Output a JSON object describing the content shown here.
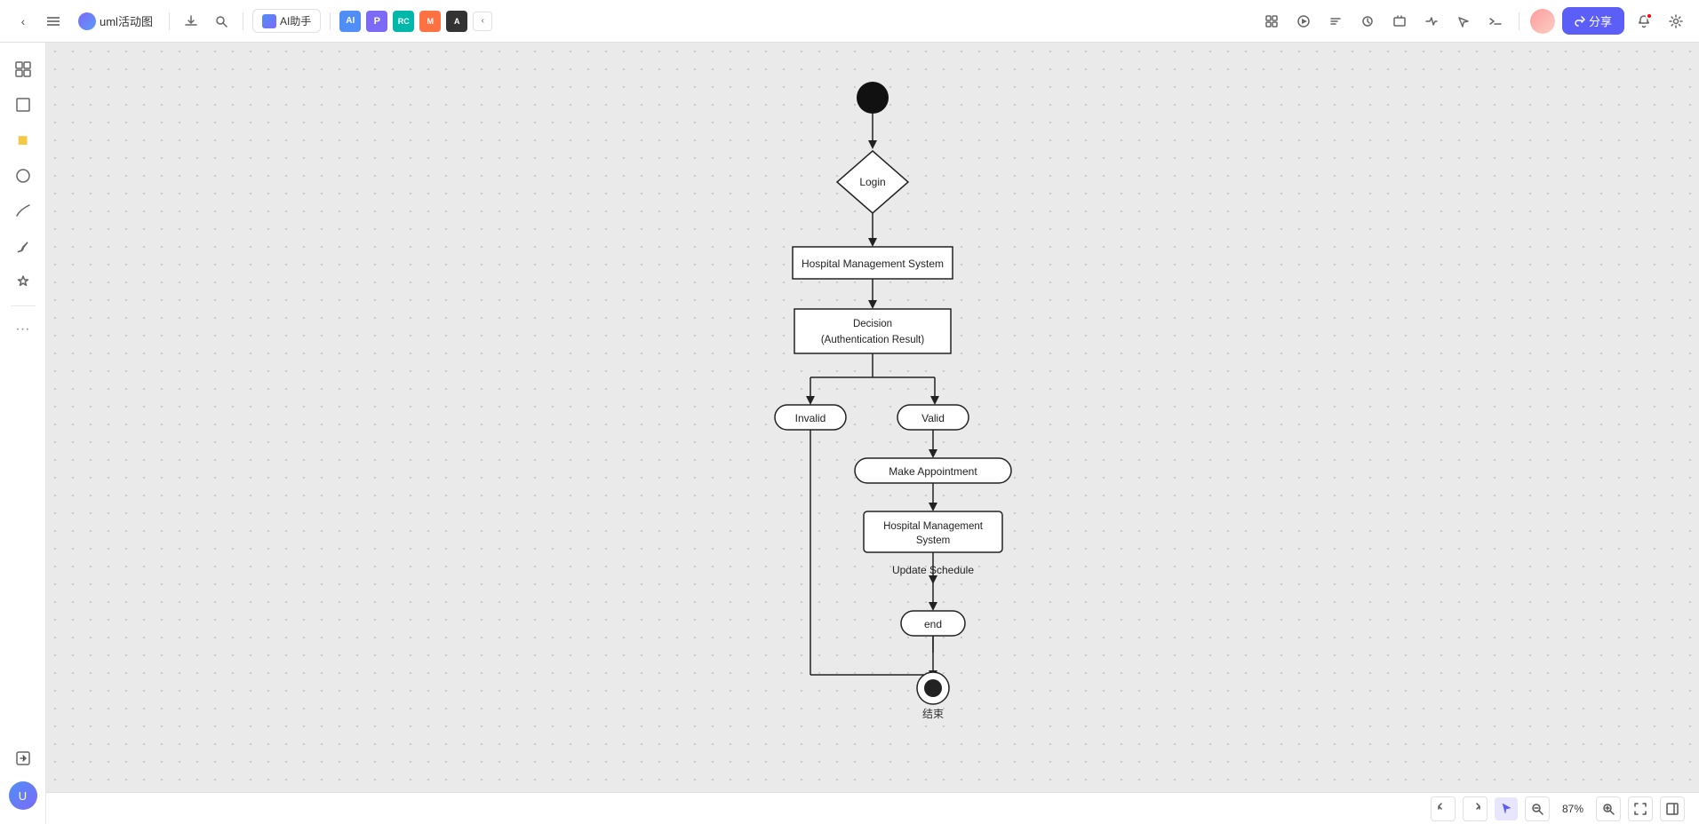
{
  "app": {
    "title": "uml活动图",
    "toolbar": {
      "back_label": "‹",
      "menu_label": "≡",
      "download_label": "⬇",
      "search_label": "🔍",
      "ai_btn_label": "AI助手",
      "chevron_label": "‹",
      "share_label": "分享",
      "zoom_level": "87%"
    },
    "plugins": [
      "P",
      "P",
      "C",
      "M",
      "A"
    ],
    "sidebar_tools": [
      "🖼",
      "⬜",
      "🟡",
      "⭕",
      "〜",
      "✏",
      "✂"
    ],
    "bottom_toolbar": {
      "undo_label": "↩",
      "redo_label": "↪",
      "cursor_label": "↖",
      "zoom_out_label": "−",
      "zoom_in_label": "+",
      "fit_label": "⊡"
    }
  },
  "diagram": {
    "nodes": {
      "start": "start",
      "login": "Login",
      "hospital_mgmt": "Hospital Management System",
      "decision": "Decision\n(Authentication Result)",
      "invalid": "Invalid",
      "valid": "Valid",
      "make_appointment": "Make Appointment",
      "hospital_mgmt2": "Hospital Management\nSystem",
      "update_schedule": "Update Schedule",
      "end_rounded": "end",
      "end_circle_label": "结束"
    }
  }
}
